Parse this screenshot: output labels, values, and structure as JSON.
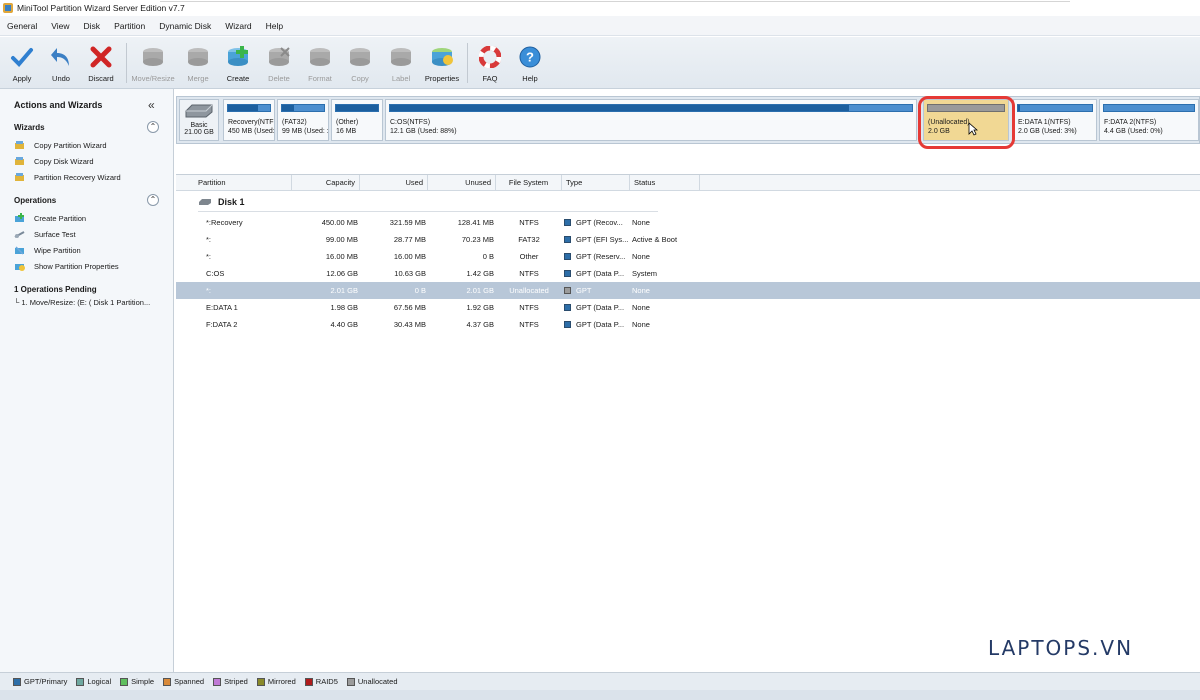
{
  "window": {
    "title": "MiniTool Partition Wizard Server Edition v7.7"
  },
  "menu": [
    "General",
    "View",
    "Disk",
    "Partition",
    "Dynamic Disk",
    "Wizard",
    "Help"
  ],
  "toolbar": {
    "apply": "Apply",
    "undo": "Undo",
    "discard": "Discard",
    "move_resize": "Move/Resize",
    "merge": "Merge",
    "create": "Create",
    "delete": "Delete",
    "format": "Format",
    "copy": "Copy",
    "label": "Label",
    "properties": "Properties",
    "faq": "FAQ",
    "help": "Help"
  },
  "sidebar": {
    "header": "Actions and Wizards",
    "collapse_glyph": "«",
    "wizards_title": "Wizards",
    "wizards": [
      "Copy Partition Wizard",
      "Copy Disk Wizard",
      "Partition Recovery Wizard"
    ],
    "operations_title": "Operations",
    "operations": [
      "Create Partition",
      "Surface Test",
      "Wipe Partition",
      "Show Partition Properties"
    ],
    "pending_title": "1 Operations Pending",
    "pending_item": "1. Move/Resize: (E: ( Disk 1 Partition..."
  },
  "disk_map": {
    "disk_type": "Basic",
    "disk_size": "21.00 GB",
    "partitions": [
      {
        "name": "Recovery(NTF",
        "detail": "450 MB (Used:",
        "used_fraction": 0.71
      },
      {
        "name": "(FAT32)",
        "detail": "99 MB (Used: :",
        "used_fraction": 0.29
      },
      {
        "name": "(Other)",
        "detail": "16 MB",
        "used_fraction": 1.0
      },
      {
        "name": "C:OS(NTFS)",
        "detail": "12.1 GB (Used: 88%)",
        "used_fraction": 0.88
      },
      {
        "name": "(Unallocated)",
        "detail": "2.0 GB",
        "used_fraction": 0.0
      },
      {
        "name": "E:DATA 1(NTFS)",
        "detail": "2.0 GB (Used: 3%)",
        "used_fraction": 0.03
      },
      {
        "name": "F:DATA 2(NTFS)",
        "detail": "4.4 GB (Used: 0%)",
        "used_fraction": 0.0
      }
    ]
  },
  "table": {
    "headers": [
      "Partition",
      "Capacity",
      "Used",
      "Unused",
      "File System",
      "Type",
      "Status"
    ],
    "disk_label": "Disk 1",
    "rows": [
      {
        "partition": "*:Recovery",
        "capacity": "450.00 MB",
        "used": "321.59 MB",
        "unused": "128.41 MB",
        "fs": "NTFS",
        "type": "GPT (Recov...",
        "status": "None"
      },
      {
        "partition": "*:",
        "capacity": "99.00 MB",
        "used": "28.77 MB",
        "unused": "70.23 MB",
        "fs": "FAT32",
        "type": "GPT (EFI Sys...",
        "status": "Active & Boot"
      },
      {
        "partition": "*:",
        "capacity": "16.00 MB",
        "used": "16.00 MB",
        "unused": "0 B",
        "fs": "Other",
        "type": "GPT (Reserv...",
        "status": "None"
      },
      {
        "partition": "C:OS",
        "capacity": "12.06 GB",
        "used": "10.63 GB",
        "unused": "1.42 GB",
        "fs": "NTFS",
        "type": "GPT (Data P...",
        "status": "System"
      },
      {
        "partition": "*:",
        "capacity": "2.01 GB",
        "used": "0 B",
        "unused": "2.01 GB",
        "fs": "Unallocated",
        "type": "GPT",
        "status": "None"
      },
      {
        "partition": "E:DATA 1",
        "capacity": "1.98 GB",
        "used": "67.56 MB",
        "unused": "1.92 GB",
        "fs": "NTFS",
        "type": "GPT (Data P...",
        "status": "None"
      },
      {
        "partition": "F:DATA 2",
        "capacity": "4.40 GB",
        "used": "30.43 MB",
        "unused": "4.37 GB",
        "fs": "NTFS",
        "type": "GPT (Data P...",
        "status": "None"
      }
    ]
  },
  "legend": [
    {
      "label": "GPT/Primary",
      "color": "#2d6ea8"
    },
    {
      "label": "Logical",
      "color": "#6fa8a0"
    },
    {
      "label": "Simple",
      "color": "#5fbf5f"
    },
    {
      "label": "Spanned",
      "color": "#d98a3a"
    },
    {
      "label": "Striped",
      "color": "#c07ad6"
    },
    {
      "label": "Mirrored",
      "color": "#8a8a2a"
    },
    {
      "label": "RAID5",
      "color": "#b01c1c"
    },
    {
      "label": "Unallocated",
      "color": "#9b9b9b"
    }
  ],
  "watermark": "LAPTOPS.VN"
}
